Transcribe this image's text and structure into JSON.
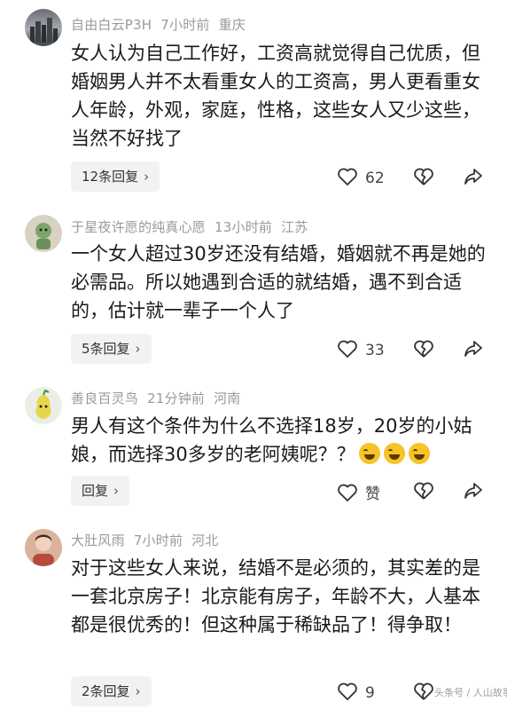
{
  "comments": [
    {
      "username": "自由白云P3H",
      "time": "7小时前",
      "location": "重庆",
      "text": "女人认为自己工作好，工资高就觉得自己优质，但婚姻男人并不太看重女人的工资高，男人更看重女人年龄，外观，家庭，性格，这些女人又少这些，当然不好找了",
      "reply_label": "12条回复",
      "likes": "62"
    },
    {
      "username": "于星夜许愿的纯真心愿",
      "time": "13小时前",
      "location": "江苏",
      "text": "一个女人超过30岁还没有结婚，婚姻就不再是她的必需品。所以她遇到合适的就结婚，遇不到合适的，估计就一辈子一个人了",
      "reply_label": "5条回复",
      "likes": "33"
    },
    {
      "username": "善良百灵鸟",
      "time": "21分钟前",
      "location": "河南",
      "text": "男人有这个条件为什么不选择18岁，20岁的小姑娘，而选择30多岁的老阿姨呢？？",
      "reply_label": "回复",
      "likes": "赞"
    },
    {
      "username": "大肚风雨",
      "time": "7小时前",
      "location": "河北",
      "text": "对于这些女人来说，结婚不是必须的，其实差的是一套北京房子！北京能有房子，年龄不大，人基本都是很优秀的！但这种属于稀缺品了！得争取！",
      "reply_label": "2条回复",
      "likes": "9"
    }
  ],
  "watermark": "头条号 / 人山故事",
  "colors": {
    "text": "#1a1a1a",
    "meta": "#9a9a9a",
    "reply_bg": "#f2f2f2"
  }
}
